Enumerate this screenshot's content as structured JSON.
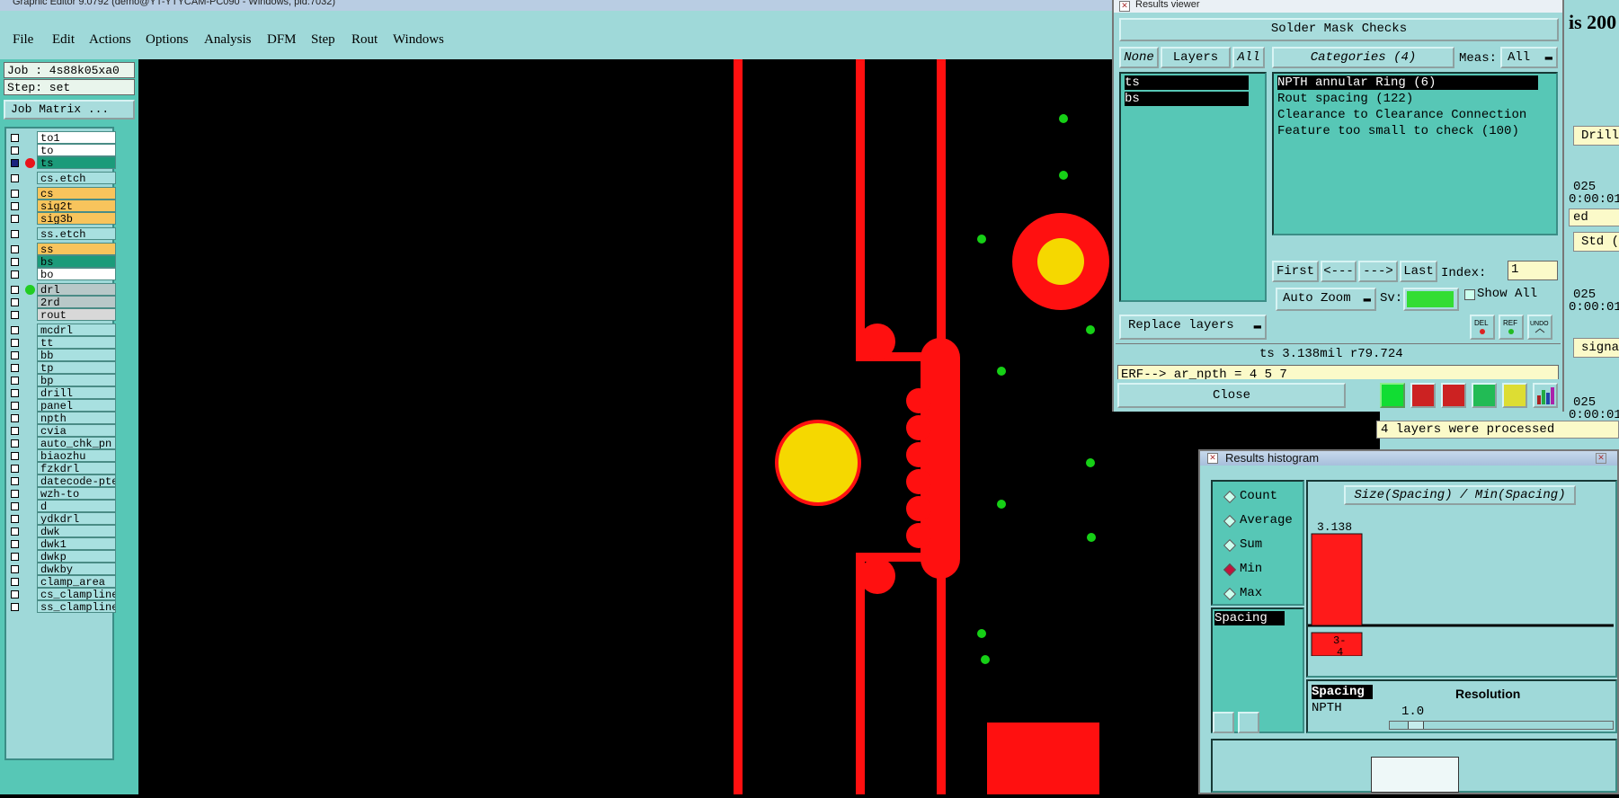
{
  "window": {
    "title": "Graphic Editor 9.0792 (demo@YT-YTYCAM-PC090 - Windows, pid:7032)"
  },
  "menu": [
    "File",
    "Edit",
    "Actions",
    "Options",
    "Analysis",
    "DFM",
    "Step",
    "Rout",
    "Windows"
  ],
  "job": {
    "job_text": "Job : 4s88k05xa0",
    "step_text": "Step: set",
    "matrix_button": "Job Matrix ..."
  },
  "layers": [
    {
      "name": "to1",
      "color": "#ffffff",
      "dot": ""
    },
    {
      "name": "to",
      "color": "#ffffff",
      "dot": ""
    },
    {
      "name": "ts",
      "color": "#1b9b7a",
      "dot": "#e8141a",
      "active": true
    },
    {
      "name": "cs.etch",
      "color": "#a8e0e0",
      "dot": ""
    },
    {
      "name": "cs",
      "color": "#f8c45c",
      "dot": ""
    },
    {
      "name": "sig2t",
      "color": "#f8c45c",
      "dot": ""
    },
    {
      "name": "sig3b",
      "color": "#f8c45c",
      "dot": ""
    },
    {
      "name": "ss.etch",
      "color": "#a8e0e0",
      "dot": ""
    },
    {
      "name": "ss",
      "color": "#f8c45c",
      "dot": ""
    },
    {
      "name": "bs",
      "color": "#1b9b7a",
      "dot": ""
    },
    {
      "name": "bo",
      "color": "#ffffff",
      "dot": ""
    },
    {
      "name": "drl",
      "color": "#b8c8c8",
      "dot": "#22cc22"
    },
    {
      "name": "2rd",
      "color": "#b8c8c8",
      "dot": ""
    },
    {
      "name": "rout",
      "color": "#d8d8d8",
      "dot": ""
    },
    {
      "name": "mcdrl",
      "color": "#a8e0e0",
      "dot": ""
    },
    {
      "name": "tt",
      "color": "#a8e0e0",
      "dot": ""
    },
    {
      "name": "bb",
      "color": "#a8e0e0",
      "dot": ""
    },
    {
      "name": "tp",
      "color": "#a8e0e0",
      "dot": ""
    },
    {
      "name": "bp",
      "color": "#a8e0e0",
      "dot": ""
    },
    {
      "name": "drill",
      "color": "#a8e0e0",
      "dot": ""
    },
    {
      "name": "panel",
      "color": "#a8e0e0",
      "dot": ""
    },
    {
      "name": "npth",
      "color": "#a8e0e0",
      "dot": ""
    },
    {
      "name": "cvia",
      "color": "#a8e0e0",
      "dot": ""
    },
    {
      "name": "auto_chk_pn",
      "color": "#a8e0e0",
      "dot": ""
    },
    {
      "name": "biaozhu",
      "color": "#a8e0e0",
      "dot": ""
    },
    {
      "name": "fzkdrl",
      "color": "#a8e0e0",
      "dot": ""
    },
    {
      "name": "datecode-pte",
      "color": "#a8e0e0",
      "dot": ""
    },
    {
      "name": "wzh-to",
      "color": "#a8e0e0",
      "dot": ""
    },
    {
      "name": "d",
      "color": "#a8e0e0",
      "dot": ""
    },
    {
      "name": "ydkdrl",
      "color": "#a8e0e0",
      "dot": ""
    },
    {
      "name": "dwk",
      "color": "#a8e0e0",
      "dot": ""
    },
    {
      "name": "dwk1",
      "color": "#a8e0e0",
      "dot": ""
    },
    {
      "name": "dwkp",
      "color": "#a8e0e0",
      "dot": ""
    },
    {
      "name": "dwkby",
      "color": "#a8e0e0",
      "dot": ""
    },
    {
      "name": "clamp_area",
      "color": "#a8e0e0",
      "dot": ""
    },
    {
      "name": "cs_clampline",
      "color": "#a8e0e0",
      "dot": ""
    },
    {
      "name": "ss_clampline",
      "color": "#a8e0e0",
      "dot": ""
    }
  ],
  "results_viewer": {
    "title": "Results viewer",
    "header": "Solder Mask Checks",
    "none_btn": "None",
    "layers_btn": "Layers",
    "all_btn": "All",
    "layer_items": [
      "ts",
      "bs"
    ],
    "categories_label": "Categories (4)",
    "meas_label": "Meas:",
    "meas_value": "All",
    "categories": [
      "NPTH annular Ring (6)",
      "Rout spacing (122)",
      "Clearance to Clearance Connection",
      "Feature too small to check (100)"
    ],
    "first_btn": "First",
    "prev_btn": "<---",
    "next_btn": "--->",
    "last_btn": "Last",
    "index_label": "Index:",
    "index_value": "1",
    "autozoom_btn": "Auto Zoom",
    "sv_label": "Sv:",
    "sv_color": "#33dd33",
    "show_all_label": "Show All",
    "replace_btn": "Replace layers",
    "info_line": "ts 3.138mil  r79.724",
    "erf_line": "ERF--> ar_npth = 4 5 7",
    "close_btn": "Close",
    "icons": [
      "del-icon",
      "ref-icon",
      "undo-icon"
    ]
  },
  "histogram": {
    "title": "Results histogram",
    "modes": [
      "Count",
      "Average",
      "Sum",
      "Min",
      "Max"
    ],
    "selected_mode": "Min",
    "list_item": "Spacing",
    "chart_title": "Size(Spacing) / Min(Spacing)",
    "bar_label": "3.138",
    "bin_label": "3-4",
    "bin_label_top": "3-",
    "bin_label_bottom": "4",
    "bar_value": 3.138,
    "info_spacing": "Spacing",
    "info_npth": "NPTH",
    "resolution_label": "Resolution",
    "resolution_value": "1.0"
  },
  "background": {
    "title_fragment": "is 200",
    "texts": [
      "Drill",
      "025",
      "0:00:01",
      "ed",
      "Std (",
      "025",
      "0:00:01",
      "signa",
      "025",
      "0:00:01",
      "4 layers were processed"
    ]
  }
}
